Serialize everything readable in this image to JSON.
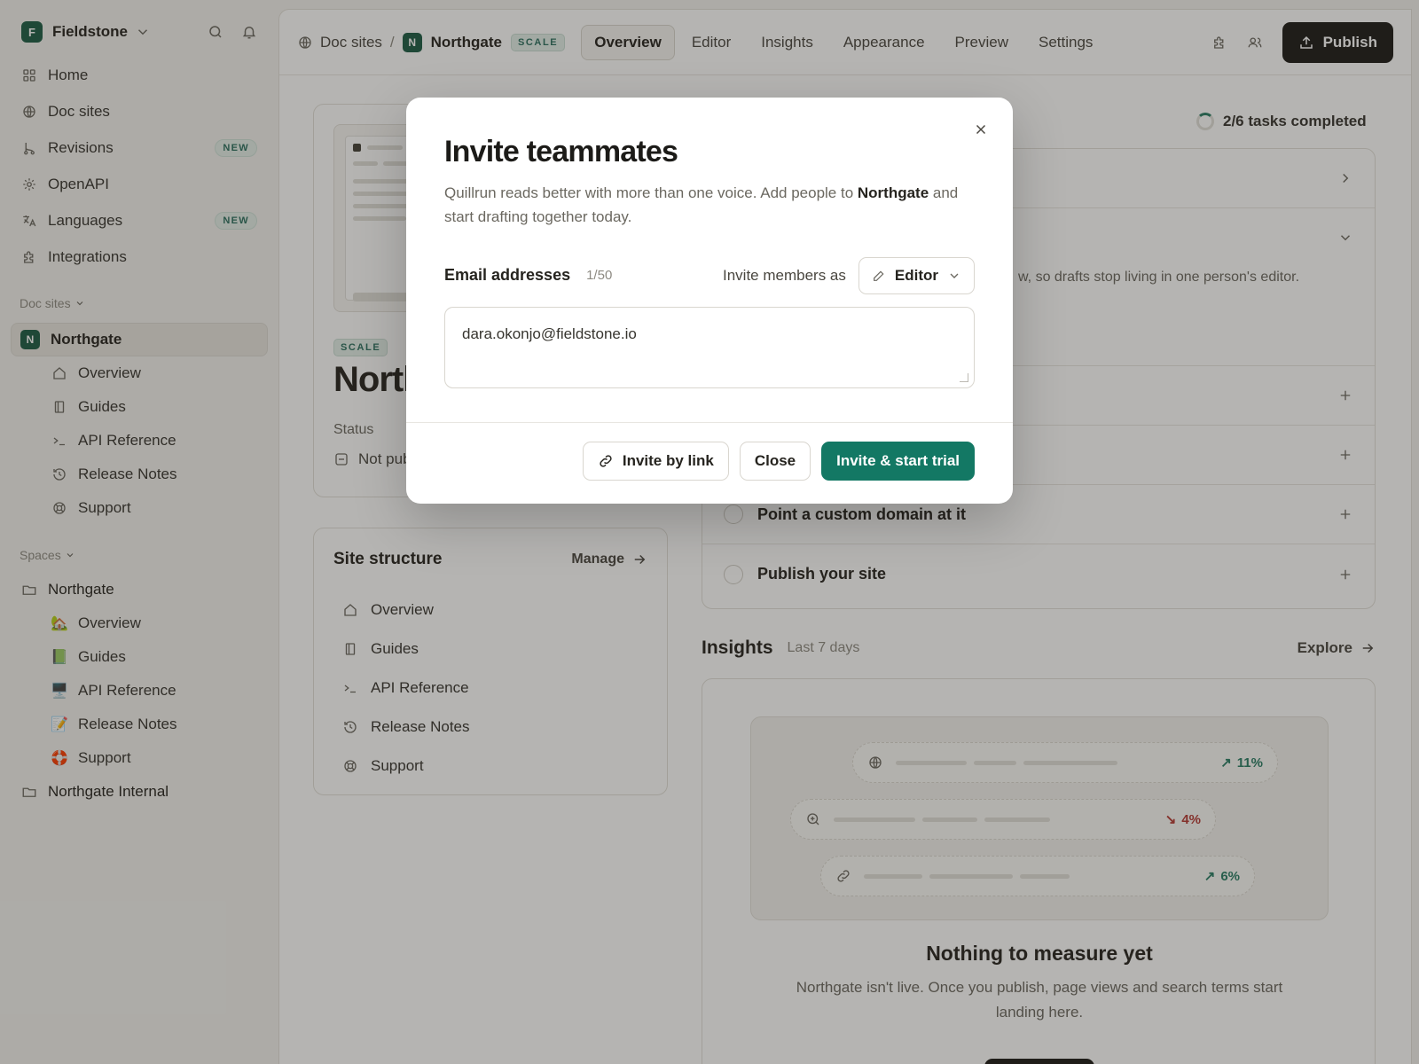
{
  "workspace": {
    "name": "Fieldstone",
    "initial": "F"
  },
  "sidebar": {
    "nav": [
      {
        "label": "Home",
        "icon": "grid-icon"
      },
      {
        "label": "Doc sites",
        "icon": "globe-icon"
      },
      {
        "label": "Revisions",
        "icon": "branch-icon",
        "badge": "NEW"
      },
      {
        "label": "OpenAPI",
        "icon": "sun-icon"
      },
      {
        "label": "Languages",
        "icon": "translate-icon",
        "badge": "NEW"
      },
      {
        "label": "Integrations",
        "icon": "puzzle-icon"
      }
    ],
    "docsites_heading": "Doc sites",
    "site": {
      "name": "Northgate",
      "initial": "N"
    },
    "site_items": [
      {
        "label": "Overview",
        "icon": "home-icon"
      },
      {
        "label": "Guides",
        "icon": "book-icon"
      },
      {
        "label": "API Reference",
        "icon": "terminal-icon"
      },
      {
        "label": "Release Notes",
        "icon": "history-icon"
      },
      {
        "label": "Support",
        "icon": "lifebuoy-icon"
      }
    ],
    "spaces_heading": "Spaces",
    "space": "Northgate",
    "space_items": [
      {
        "label": "Overview",
        "emoji": "🏡"
      },
      {
        "label": "Guides",
        "emoji": "📗"
      },
      {
        "label": "API Reference",
        "emoji": "🖥️"
      },
      {
        "label": "Release Notes",
        "emoji": "📝"
      },
      {
        "label": "Support",
        "emoji": "🛟"
      }
    ],
    "space2": "Northgate Internal"
  },
  "topbar": {
    "crumb_root": "Doc sites",
    "crumb_sep": "/",
    "crumb_site": "Northgate",
    "crumb_site_initial": "N",
    "tier": "SCALE",
    "tabs": [
      "Overview",
      "Editor",
      "Insights",
      "Appearance",
      "Preview",
      "Settings"
    ],
    "active_tab": "Overview",
    "publish_label": "Publish"
  },
  "site_card": {
    "tier": "SCALE",
    "title": "Northgate",
    "status_label": "Status",
    "status_value": "Not published"
  },
  "structure": {
    "title": "Site structure",
    "manage_label": "Manage",
    "items": [
      {
        "label": "Overview",
        "icon": "home-icon"
      },
      {
        "label": "Guides",
        "icon": "book-icon"
      },
      {
        "label": "API Reference",
        "icon": "terminal-icon"
      },
      {
        "label": "Release Notes",
        "icon": "history-icon"
      },
      {
        "label": "Support",
        "icon": "lifebuoy-icon"
      }
    ]
  },
  "tasks": {
    "progress": "2/6 tasks completed",
    "completed": 2,
    "total": 6,
    "partial_desc": "w, so drafts stop living in one person's editor.",
    "visible": [
      "Point a custom domain at it",
      "Publish your site"
    ]
  },
  "insights": {
    "title": "Insights",
    "period": "Last 7 days",
    "explore_label": "Explore",
    "metrics": [
      {
        "icon": "globe-icon",
        "trend": "up",
        "value": "11%"
      },
      {
        "icon": "search-icon",
        "trend": "down",
        "value": "4%"
      },
      {
        "icon": "link-icon",
        "trend": "up",
        "value": "6%"
      }
    ],
    "empty_title": "Nothing to measure yet",
    "empty_body": "Northgate isn't live. Once you publish, page views and search terms start landing here."
  },
  "modal": {
    "title": "Invite teammates",
    "desc_before": "Quillrun reads better with more than one voice. Add people to ",
    "desc_site": "Northgate",
    "desc_after": " and start drafting together today.",
    "emails_label": "Email addresses",
    "emails_count": "1/50",
    "role_label": "Invite members as",
    "role_value": "Editor",
    "email_value": "dara.okonjo@fieldstone.io",
    "invite_link_label": "Invite by link",
    "close_label": "Close",
    "primary_label": "Invite & start trial"
  },
  "colors": {
    "brand": "#1c5b45",
    "primary": "#137864",
    "up": "#2a7d65",
    "down": "#b53a35"
  }
}
